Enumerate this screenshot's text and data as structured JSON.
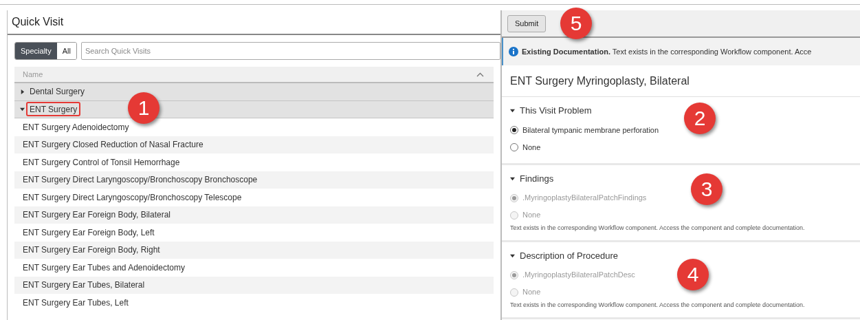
{
  "quick_visit": {
    "title": "Quick Visit",
    "filter_tabs": [
      {
        "label": "Specialty",
        "selected": true
      },
      {
        "label": "All",
        "selected": false
      }
    ],
    "search": {
      "placeholder": "Search Quick Visits"
    },
    "table": {
      "columns": [
        {
          "label": "Name",
          "sorted": true
        }
      ],
      "rows": [
        {
          "kind": "group",
          "label": "Dental Surgery",
          "expanded": false,
          "outlined": false
        },
        {
          "kind": "group",
          "label": "ENT Surgery",
          "expanded": true,
          "outlined": true,
          "callout": "1"
        },
        {
          "kind": "item",
          "label": "ENT Surgery Adenoidectomy"
        },
        {
          "kind": "item",
          "label": "ENT Surgery Closed Reduction of Nasal Fracture"
        },
        {
          "kind": "item",
          "label": "ENT Surgery Control of Tonsil Hemorrhage"
        },
        {
          "kind": "item",
          "label": "ENT Surgery Direct Laryngoscopy/Bronchoscopy Bronchoscope"
        },
        {
          "kind": "item",
          "label": "ENT Surgery Direct Laryngoscopy/Bronchoscopy Telescope"
        },
        {
          "kind": "item",
          "label": "ENT Surgery Ear Foreign Body, Bilateral"
        },
        {
          "kind": "item",
          "label": "ENT Surgery Ear Foreign Body, Left"
        },
        {
          "kind": "item",
          "label": "ENT Surgery Ear Foreign Body, Right"
        },
        {
          "kind": "item",
          "label": "ENT Surgery Ear Tubes and Adenoidectomy"
        },
        {
          "kind": "item",
          "label": "ENT Surgery Ear Tubes, Bilateral"
        },
        {
          "kind": "item",
          "label": "ENT Surgery Ear Tubes, Left"
        }
      ]
    }
  },
  "form": {
    "submit_button": {
      "label": "Submit",
      "callout": "5"
    },
    "banner": {
      "title": "Existing Documentation.",
      "text": "Text exists in the corresponding Workflow component. Acce"
    },
    "title": "ENT Surgery Myringoplasty, Bilateral",
    "sections": [
      {
        "title": "This Visit Problem",
        "expanded": true,
        "disabled": false,
        "callout": "2",
        "options": [
          {
            "label": "Bilateral tympanic membrane perforation",
            "selected": true
          },
          {
            "label": "None",
            "selected": false
          }
        ]
      },
      {
        "title": "Findings",
        "expanded": true,
        "disabled": true,
        "callout": "3",
        "options": [
          {
            "label": ".MyringoplastyBilateralPatchFindings",
            "selected": true
          },
          {
            "label": "None",
            "selected": false
          }
        ],
        "note": "Text exists in the corresponding Workflow component. Access the component and complete documentation."
      },
      {
        "title": "Description of Procedure",
        "expanded": true,
        "disabled": true,
        "callout": "4",
        "options": [
          {
            "label": ".MyringoplastyBilateralPatchDesc",
            "selected": true
          },
          {
            "label": "None",
            "selected": false
          }
        ],
        "note": "Text exists in the corresponding Workflow component. Access the component and complete documentation."
      }
    ]
  }
}
